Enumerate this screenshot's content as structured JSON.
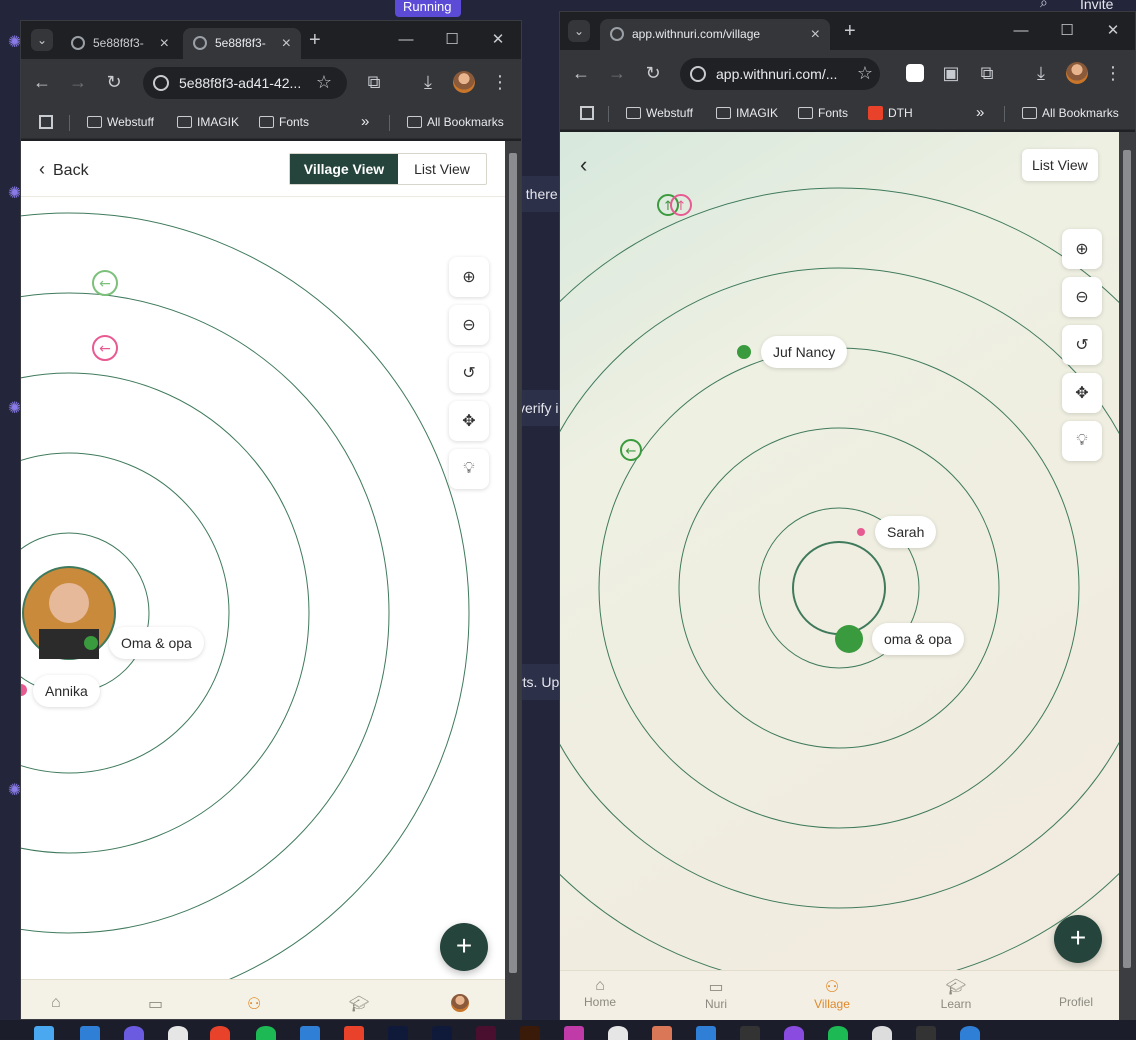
{
  "background_app": {
    "running_label": "Running",
    "invite_label": "Invite",
    "snippets": [
      "t there",
      "verify i",
      "rts. Up"
    ]
  },
  "left_window": {
    "tabs": [
      {
        "label": "5e88f8f3-"
      },
      {
        "label": "5e88f8f3-"
      }
    ],
    "address": "5e88f8f3-ad41-42...",
    "bookmarks": [
      "Webstuff",
      "IMAGIK",
      "Fonts"
    ],
    "all_bookmarks": "All Bookmarks",
    "overflow": "»",
    "app": {
      "back_label": "Back",
      "view_toggle": {
        "active": "Village View",
        "inactive": "List View"
      },
      "labels": {
        "oma_opa": "Oma & opa",
        "annika": "Annika"
      },
      "fab_label": "+"
    }
  },
  "right_window": {
    "tab": {
      "label": "app.withnuri.com/village"
    },
    "address": "app.withnuri.com/...",
    "bookmarks": [
      "Webstuff",
      "IMAGIK",
      "Fonts",
      "DTH"
    ],
    "all_bookmarks": "All Bookmarks",
    "overflow": "»",
    "app": {
      "list_view_label": "List View",
      "labels": {
        "juf_nancy": "Juf Nancy",
        "sarah": "Sarah",
        "oma_opa": "oma & opa"
      },
      "fab_label": "+",
      "nav": [
        "Home",
        "Nuri",
        "Village",
        "Learn",
        "Profiel"
      ],
      "active_nav": "Village"
    }
  },
  "colors": {
    "accent_dark": "#25443b",
    "ring": "#3f7a5c",
    "green_dot": "#3a9a3e",
    "pink": "#e85a92",
    "active_orange": "#e08a2a"
  }
}
